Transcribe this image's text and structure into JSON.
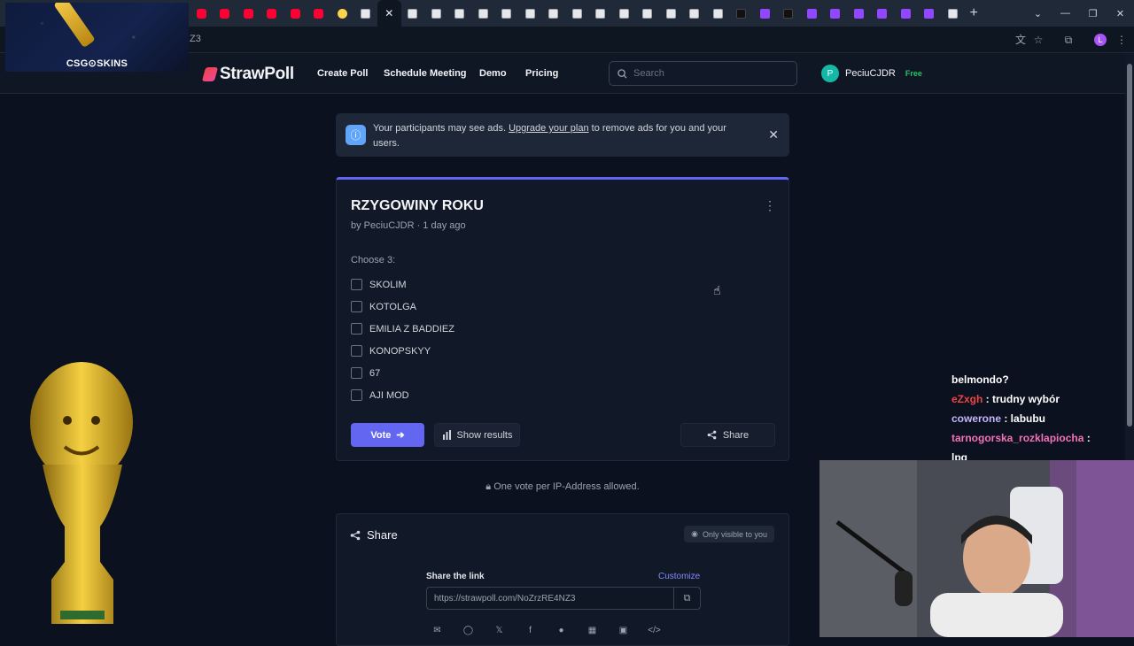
{
  "browser": {
    "tabs": [
      {
        "type": "yt"
      },
      {
        "type": "yt"
      },
      {
        "type": "yt"
      },
      {
        "type": "yt"
      },
      {
        "type": "yt"
      },
      {
        "type": "yt"
      },
      {
        "type": "ys"
      },
      {
        "type": "gen"
      },
      {
        "type": "active"
      },
      {
        "type": "gen"
      },
      {
        "type": "gen"
      },
      {
        "type": "gen"
      },
      {
        "type": "gen"
      },
      {
        "type": "gen"
      },
      {
        "type": "gen"
      },
      {
        "type": "gen"
      },
      {
        "type": "gen"
      },
      {
        "type": "gen"
      },
      {
        "type": "gen"
      },
      {
        "type": "gen"
      },
      {
        "type": "gen"
      },
      {
        "type": "gen"
      },
      {
        "type": "gen"
      },
      {
        "type": "tk"
      },
      {
        "type": "tw"
      },
      {
        "type": "tk"
      },
      {
        "type": "tw"
      },
      {
        "type": "tw"
      },
      {
        "type": "tw"
      },
      {
        "type": "tw"
      },
      {
        "type": "tw"
      },
      {
        "type": "tw"
      },
      {
        "type": "gen"
      }
    ],
    "active_tab_close": "✕",
    "new_tab": "+",
    "url_fragment": "Z3",
    "profile_initial": "L"
  },
  "overlay": {
    "logo_text": "CSG⊙SKINS"
  },
  "nav": {
    "brand": "StrawPoll",
    "links": [
      "Create Poll",
      "Schedule Meeting",
      "Demo",
      "Pricing"
    ],
    "search_placeholder": "Search",
    "user_initial": "P",
    "username": "PeciuCJDR",
    "plan": "Free"
  },
  "banner": {
    "text_before": "Your participants may see ads. ",
    "link": "Upgrade your plan",
    "text_after": " to remove ads for you and your users."
  },
  "poll": {
    "title": "RZYGOWINY ROKU",
    "meta": "by PeciuCJDR · 1 day ago",
    "instruction": "Choose 3:",
    "options": [
      "SKOLIM",
      "KOTOLGA",
      "EMILIA Z BADDIEZ",
      "KONOPSKYY",
      "67",
      "AJI MOD"
    ],
    "vote_label": "Vote",
    "show_results_label": "Show results",
    "share_label": "Share"
  },
  "vote_notice": "One vote per IP-Address allowed.",
  "share": {
    "title": "Share",
    "visibility": "Only visible to you",
    "link_label": "Share the link",
    "customize": "Customize",
    "link": "https://strawpoll.com/NoZrzRE4NZ3",
    "socials": [
      "email-icon",
      "whatsapp-icon",
      "twitter-icon",
      "facebook-icon",
      "reddit-icon",
      "qr-icon",
      "embed-image-icon",
      "code-icon"
    ]
  },
  "chat": [
    {
      "user": "belmondo?",
      "msg": "",
      "color": "#ffffff"
    },
    {
      "user": "eZxgh",
      "msg": " : trudny wybór",
      "color": "#ef4444"
    },
    {
      "user": "cowerone",
      "msg": " : labubu",
      "color": "#c4b5fd"
    },
    {
      "user": "tarnogorska_rozklapiocha",
      "msg": " :",
      "color": "#f472b6"
    },
    {
      "user": "",
      "msg": "lpg",
      "color": "#ffffff"
    }
  ],
  "colors": {
    "accent": "#6366f1",
    "brand": "#ef4444",
    "free": "#22c55e"
  }
}
